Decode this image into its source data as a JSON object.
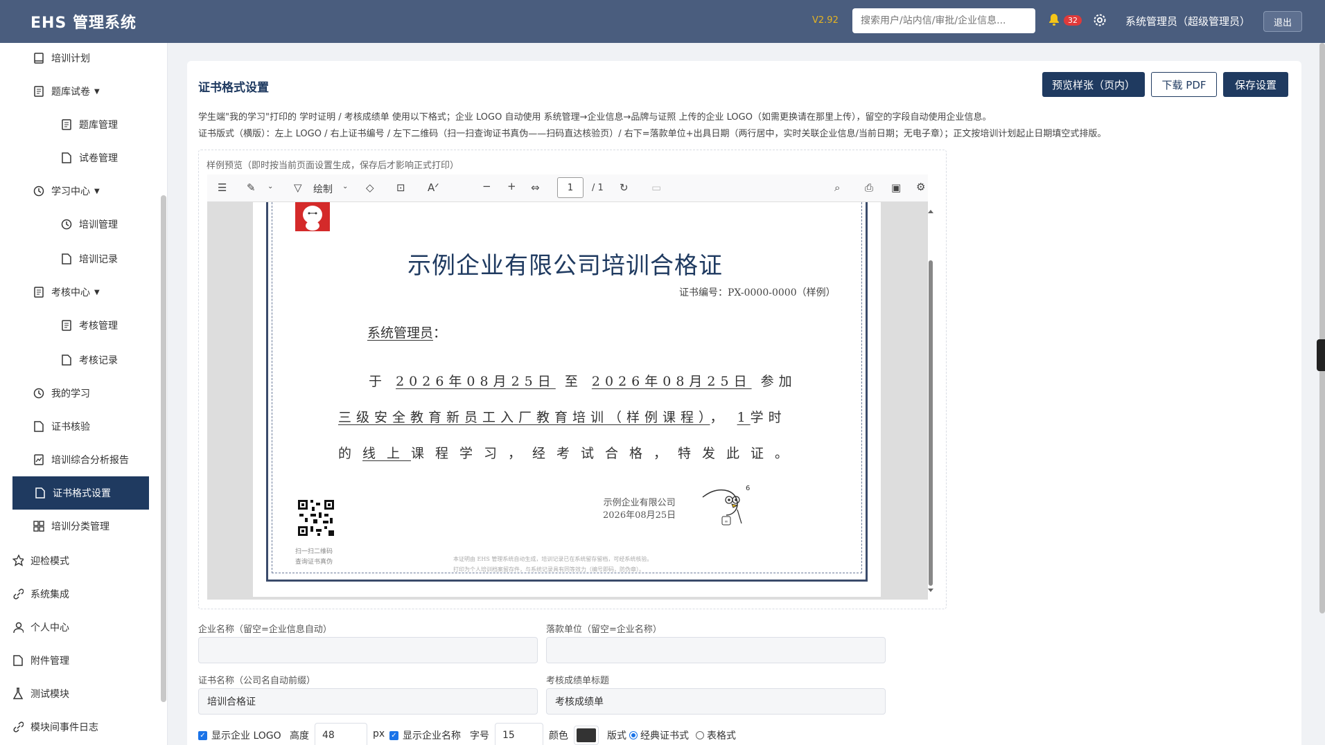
{
  "header": {
    "logo": "EHS 管理系统",
    "version": "V2.92",
    "search_placeholder": "搜索用户/站内信/审批/企业信息...",
    "notification_count": "32",
    "user": "系统管理员（超级管理员）",
    "logout": "退出"
  },
  "sidebar": {
    "training_plan": "培训计划",
    "question_bank": "题库试卷",
    "question_mgmt": "题库管理",
    "paper_mgmt": "试卷管理",
    "learning_center": "学习中心",
    "training_mgmt": "培训管理",
    "training_records": "培训记录",
    "exam_center": "考核中心",
    "exam_mgmt": "考核管理",
    "exam_records": "考核记录",
    "my_learning": "我的学习",
    "cert_verify": "证书核验",
    "analysis_report": "培训综合分析报告",
    "cert_format": "证书格式设置",
    "category_mgmt": "培训分类管理",
    "inspection_mode": "迎检模式",
    "system_integration": "系统集成",
    "personal_center": "个人中心",
    "attachments": "附件管理",
    "test_module": "测试模块",
    "event_log": "模块间事件日志"
  },
  "main": {
    "title": "证书格式设置",
    "btn_preview": "预览样张（页内）",
    "btn_download": "下载 PDF",
    "btn_save": "保存设置",
    "desc1": "学生端\"我的学习\"打印的 学时证明 / 考核成绩单 使用以下格式；企业 LOGO 自动使用 系统管理→企业信息→品牌与证照 上传的企业 LOGO（如需更换请在那里上传），留空的字段自动使用企业信息。",
    "desc2": "证书版式（横版）：左上 LOGO / 右上证书编号 / 左下二维码（扫一扫查询证书真伪——扫码直达核验页）/ 右下=落款单位+出具日期（两行居中，实时关联企业信息/当前日期；无电子章）；正文按培训计划起止日期填空式排版。",
    "preview_label": "样例预览（即时按当前页面设置生成，保存后才影响正式打印）"
  },
  "pdf": {
    "draw_label": "绘制",
    "page_current": "1",
    "page_total": "/ 1"
  },
  "cert": {
    "title": "示例企业有限公司培训合格证",
    "number": "证书编号：PX-0000-0000（样例）",
    "name": "系统管理员",
    "name_suffix": "：",
    "l1_a": "于",
    "l1_date1": "2026年08月25日",
    "l1_b": "至",
    "l1_date2": "2026年08月25日",
    "l1_c": "参加",
    "l2_course": "三级安全教育新员工入厂教育培训（样例课程）",
    "l2_sep": "，",
    "l2_hours": "1",
    "l2_unit": "学时",
    "l3_a": "的",
    "l3_mode": "线上",
    "l3_b": "课程学习，经考试合格，特发此证。",
    "qr_caption1": "扫一扫二维码",
    "qr_caption2": "查询证书真伪",
    "issuer": "示例企业有限公司",
    "issue_date": "2026年08月25日",
    "footer1": "本证明由 EHS 管理系统自动生成，培训记录已在系统留存留档，可经系统核验。",
    "footer2": "打印为个人培训档案留存件，与系统记录具有同等效力（编号即码，防伪章）。"
  },
  "form": {
    "company_label": "企业名称（留空=企业信息自动）",
    "company_value": "",
    "issuer_label": "落款单位（留空=企业名称）",
    "issuer_value": "",
    "cert_name_label": "证书名称（公司名自动前缀）",
    "cert_name_value": "培训合格证",
    "score_title_label": "考核成绩单标题",
    "score_title_value": "考核成绩单",
    "show_logo": "显示企业 LOGO",
    "height_label": "高度",
    "height_value": "48",
    "px": "px",
    "show_company": "显示企业名称",
    "font_size_label": "字号",
    "font_size_value": "15",
    "color_label": "颜色",
    "color_value": "#333333",
    "layout_label": "版式",
    "layout_classic": "经典证书式",
    "layout_table": "表格式"
  },
  "colors": {
    "header": "#4a5d7e",
    "primary": "#1f3a60",
    "accent": "#1a73e8"
  }
}
